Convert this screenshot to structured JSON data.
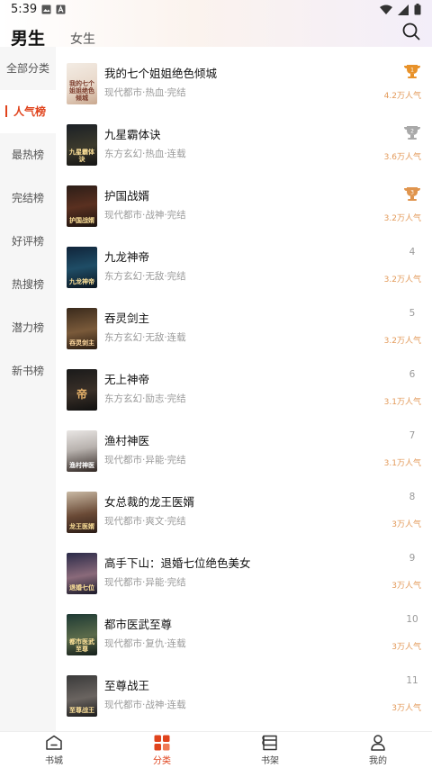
{
  "status_bar": {
    "time": "5:39"
  },
  "header": {
    "tab_male": "男生",
    "tab_female": "女生"
  },
  "sidebar": {
    "items": [
      {
        "label": "全部分类"
      },
      {
        "label": "人气榜"
      },
      {
        "label": "最热榜"
      },
      {
        "label": "完结榜"
      },
      {
        "label": "好评榜"
      },
      {
        "label": "热搜榜"
      },
      {
        "label": "潜力榜"
      },
      {
        "label": "新书榜"
      }
    ],
    "active_index": 1
  },
  "books": [
    {
      "title": "我的七个姐姐绝色倾城",
      "tags": "现代都市·热血·完结",
      "rank": "",
      "rank_badge": "gold",
      "popularity": "4.2万人气",
      "cover_text": "我的七个姐姐绝色倾城"
    },
    {
      "title": "九星霸体诀",
      "tags": "东方玄幻·热血·连载",
      "rank": "",
      "rank_badge": "silver",
      "popularity": "3.6万人气",
      "cover_text": "九星霸体诀"
    },
    {
      "title": "护国战婿",
      "tags": "现代都市·战神·完结",
      "rank": "",
      "rank_badge": "bronze",
      "popularity": "3.2万人气",
      "cover_text": "护国战婿"
    },
    {
      "title": "九龙神帝",
      "tags": "东方玄幻·无敌·完结",
      "rank": "4",
      "rank_badge": "",
      "popularity": "3.2万人气",
      "cover_text": "九龙神帝"
    },
    {
      "title": "吞灵剑主",
      "tags": "东方玄幻·无敌·连载",
      "rank": "5",
      "rank_badge": "",
      "popularity": "3.2万人气",
      "cover_text": "吞灵剑主"
    },
    {
      "title": "无上神帝",
      "tags": "东方玄幻·励志·完结",
      "rank": "6",
      "rank_badge": "",
      "popularity": "3.1万人气",
      "cover_text": "帝"
    },
    {
      "title": "渔村神医",
      "tags": "现代都市·异能·完结",
      "rank": "7",
      "rank_badge": "",
      "popularity": "3.1万人气",
      "cover_text": "渔村神医"
    },
    {
      "title": "女总裁的龙王医婿",
      "tags": "现代都市·爽文·完结",
      "rank": "8",
      "rank_badge": "",
      "popularity": "3万人气",
      "cover_text": "龙王医婿"
    },
    {
      "title": "高手下山：退婚七位绝色美女",
      "tags": "现代都市·异能·完结",
      "rank": "9",
      "rank_badge": "",
      "popularity": "3万人气",
      "cover_text": "退婚七位"
    },
    {
      "title": "都市医武至尊",
      "tags": "现代都市·复仇·连载",
      "rank": "10",
      "rank_badge": "",
      "popularity": "3万人气",
      "cover_text": "都市医武至尊"
    },
    {
      "title": "至尊战王",
      "tags": "现代都市·战神·连载",
      "rank": "11",
      "rank_badge": "",
      "popularity": "3万人气",
      "cover_text": "至尊战王"
    }
  ],
  "bottom_nav": {
    "items": [
      {
        "label": "书城",
        "icon": "bookstore-icon"
      },
      {
        "label": "分类",
        "icon": "category-icon"
      },
      {
        "label": "书架",
        "icon": "bookshelf-icon"
      },
      {
        "label": "我的",
        "icon": "profile-icon"
      }
    ],
    "active_index": 1
  },
  "colors": {
    "accent": "#e0431c",
    "popularity": "#e39a5a",
    "gold": "#e8922a",
    "silver": "#a9a9a9",
    "bronze": "#e0954e"
  }
}
